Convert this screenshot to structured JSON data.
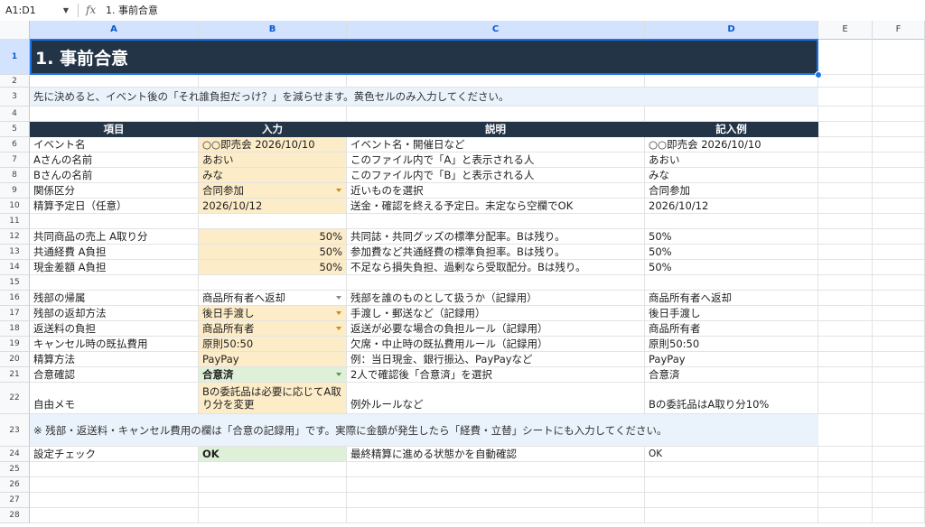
{
  "formula_bar": {
    "name_box": "A1:D1",
    "fx_label": "fx",
    "content": "1. 事前合意"
  },
  "columns": [
    "A",
    "B",
    "C",
    "D",
    "E",
    "F"
  ],
  "row_numbers": [
    "1",
    "2",
    "3",
    "4",
    "5",
    "6",
    "7",
    "8",
    "9",
    "10",
    "11",
    "12",
    "13",
    "14",
    "15",
    "16",
    "17",
    "18",
    "19",
    "20",
    "21",
    "22",
    "23",
    "24",
    "25",
    "26",
    "27",
    "28"
  ],
  "title": "1. 事前合意",
  "instruction": "先に決めると、イベント後の「それ誰負担だっけ？」を減らせます。黄色セルのみ入力してください。",
  "table_headers": {
    "item": "項目",
    "input": "入力",
    "description": "説明",
    "example": "記入例"
  },
  "rows": {
    "r6": {
      "item": "イベント名",
      "input": "○○即売会 2026/10/10",
      "desc": "イベント名・開催日など",
      "example": "○○即売会 2026/10/10"
    },
    "r7": {
      "item": "Aさんの名前",
      "input": "あおい",
      "desc": "このファイル内で「A」と表示される人",
      "example": "あおい"
    },
    "r8": {
      "item": "Bさんの名前",
      "input": "みな",
      "desc": "このファイル内で「B」と表示される人",
      "example": "みな"
    },
    "r9": {
      "item": "関係区分",
      "input": "合同参加",
      "desc": "近いものを選択",
      "example": "合同参加"
    },
    "r10": {
      "item": "精算予定日（任意）",
      "input": "2026/10/12",
      "desc": "送金・確認を終える予定日。未定なら空欄でOK",
      "example": "2026/10/12"
    },
    "r12": {
      "item": "共同商品の売上 A取り分",
      "input": "50%",
      "desc": "共同誌・共同グッズの標準分配率。Bは残り。",
      "example": "50%"
    },
    "r13": {
      "item": "共通経費 A負担",
      "input": "50%",
      "desc": "参加費など共通経費の標準負担率。Bは残り。",
      "example": "50%"
    },
    "r14": {
      "item": "現金差額 A負担",
      "input": "50%",
      "desc": "不足なら損失負担、過剰なら受取配分。Bは残り。",
      "example": "50%"
    },
    "r16": {
      "item": "残部の帰属",
      "input": "商品所有者へ返却",
      "desc": "残部を誰のものとして扱うか（記録用）",
      "example": "商品所有者へ返却"
    },
    "r17": {
      "item": "残部の返却方法",
      "input": "後日手渡し",
      "desc": "手渡し・郵送など（記録用）",
      "example": "後日手渡し"
    },
    "r18": {
      "item": "返送料の負担",
      "input": "商品所有者",
      "desc": "返送が必要な場合の負担ルール（記録用）",
      "example": "商品所有者"
    },
    "r19": {
      "item": "キャンセル時の既払費用",
      "input": "原則50:50",
      "desc": "欠席・中止時の既払費用ルール（記録用）",
      "example": "原則50:50"
    },
    "r20": {
      "item": "精算方法",
      "input": "PayPay",
      "desc": "例：当日現金、銀行振込、PayPayなど",
      "example": "PayPay"
    },
    "r21": {
      "item": "合意確認",
      "input": "合意済",
      "desc": "2人で確認後「合意済」を選択",
      "example": "合意済"
    },
    "r22": {
      "item": "自由メモ",
      "input": "Bの委託品は必要に応じてA取り分を変更",
      "desc": "例外ルールなど",
      "example": "Bの委託品はA取り分10%"
    },
    "r24": {
      "item": "設定チェック",
      "input": "OK",
      "desc": "最終精算に進める状態かを自動確認",
      "example": "OK"
    }
  },
  "note": "※ 残部・返送料・キャンセル費用の欄は「合意の記録用」です。実際に金額が発生したら「経費・立替」シートにも入力してください。",
  "colors": {
    "header_bg": "#243447",
    "input_yellow": "#fdecc8",
    "input_green": "#dff0d8",
    "note_bg": "#eaf3fb",
    "selection": "#1a73e8"
  }
}
